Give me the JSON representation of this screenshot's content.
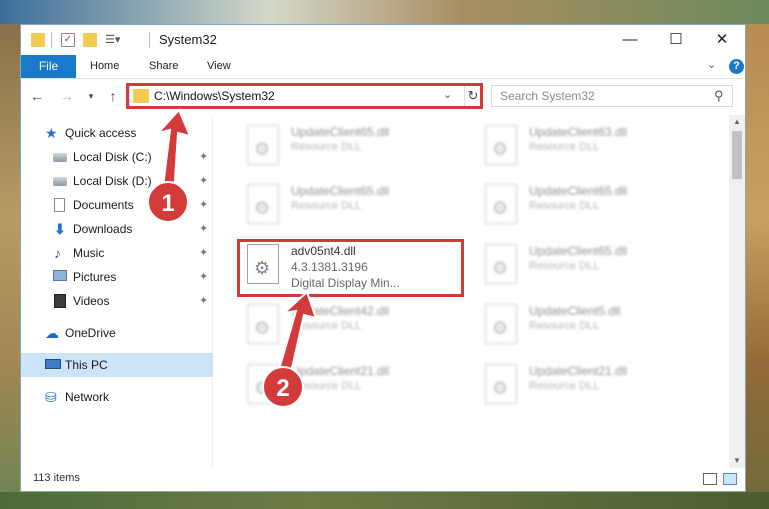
{
  "window": {
    "title": "System32",
    "buttons": {
      "minimize": "—",
      "maximize": "☐",
      "close": "✕"
    }
  },
  "ribbon": {
    "file": "File",
    "tabs": [
      "Home",
      "Share",
      "View"
    ]
  },
  "nav": {
    "address": "C:\\Windows\\System32",
    "search_placeholder": "Search System32"
  },
  "sidebar": {
    "quick_access": "Quick access",
    "items": [
      {
        "label": "Local Disk (C:)",
        "icon": "drive-icon"
      },
      {
        "label": "Local Disk (D:)",
        "icon": "drive-icon"
      },
      {
        "label": "Documents",
        "icon": "documents-icon"
      },
      {
        "label": "Downloads",
        "icon": "downloads-icon"
      },
      {
        "label": "Music",
        "icon": "music-icon"
      },
      {
        "label": "Pictures",
        "icon": "pictures-icon"
      },
      {
        "label": "Videos",
        "icon": "videos-icon"
      }
    ],
    "onedrive": "OneDrive",
    "this_pc": "This PC",
    "network": "Network"
  },
  "files": [
    {
      "name": "UpdateClient65.dll",
      "type": "Resource DLL",
      "blurred": true
    },
    {
      "name": "UpdateClient63.dll",
      "type": "Resource DLL",
      "blurred": true
    },
    {
      "name": "UpdateClient65.dll",
      "type": "Resource DLL",
      "blurred": true
    },
    {
      "name": "UpdateClient65.dll",
      "type": "Resource DLL",
      "blurred": true
    },
    {
      "name": "adv05nt4.dll",
      "type": "4.3.1381.3196",
      "desc": "Digital Display Min...",
      "blurred": false
    },
    {
      "name": "UpdateClient65.dll",
      "type": "Resource DLL",
      "blurred": true
    },
    {
      "name": "UpdateClient42.dll",
      "type": "Resource DLL",
      "blurred": true
    },
    {
      "name": "UpdateClient5.dll",
      "type": "Resource DLL",
      "blurred": true
    },
    {
      "name": "UpdateClient21.dll",
      "type": "Resource DLL",
      "blurred": true
    },
    {
      "name": "UpdateClient21.dll",
      "type": "Resource DLL",
      "blurred": true
    }
  ],
  "status": {
    "items": "113 items"
  },
  "callouts": [
    "1",
    "2"
  ]
}
